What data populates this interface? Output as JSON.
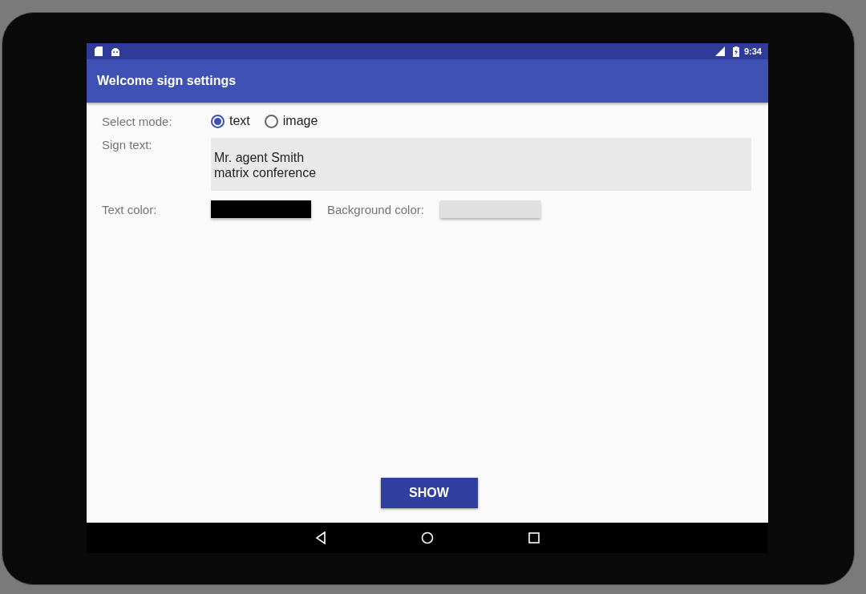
{
  "status_bar": {
    "time": "9:34"
  },
  "app_bar": {
    "title": "Welcome sign settings"
  },
  "mode": {
    "label": "Select mode:",
    "options": [
      {
        "label": "text",
        "selected": true
      },
      {
        "label": "image",
        "selected": false
      }
    ]
  },
  "sign_text": {
    "label": "Sign text:",
    "value": "Mr. agent Smith\nmatrix conference"
  },
  "color_fields": [
    {
      "label": "Text color:",
      "color": "#000000"
    },
    {
      "label": "Background color:",
      "color": "#e0e0e0"
    }
  ],
  "button": {
    "label": "SHOW"
  }
}
